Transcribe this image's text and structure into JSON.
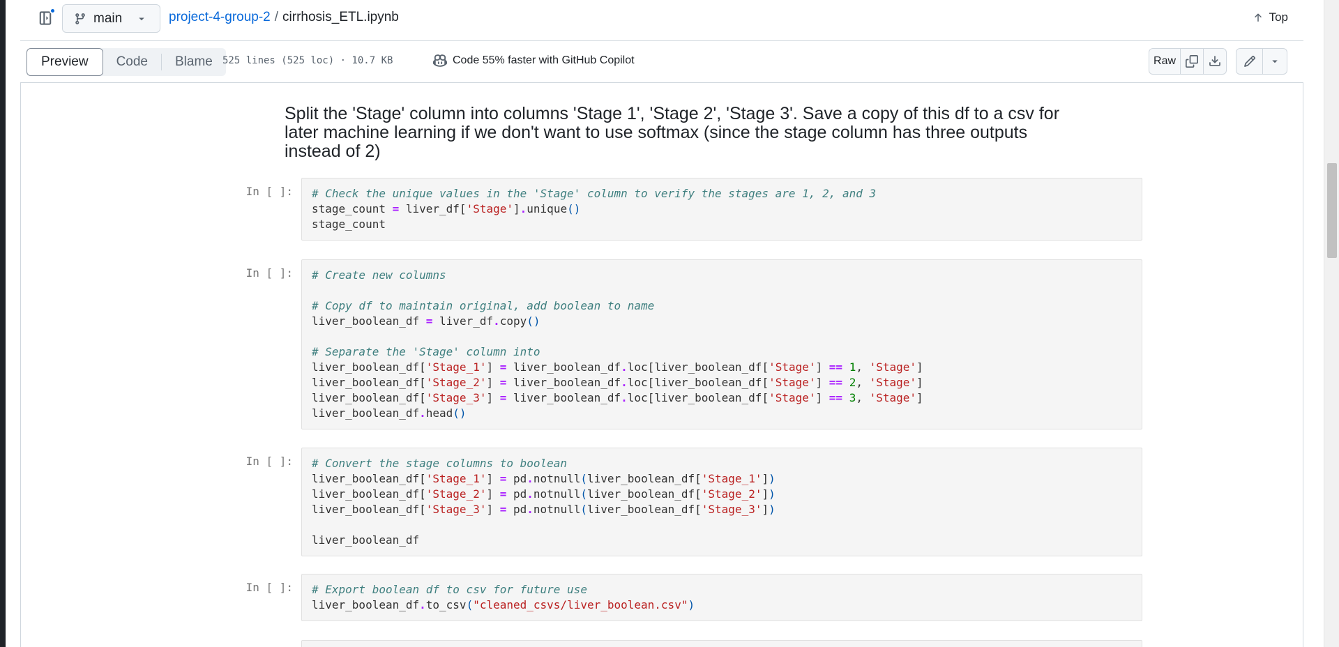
{
  "header": {
    "branch": "main",
    "repo": "project-4-group-2",
    "separator": "/",
    "filename": "cirrhosis_ETL.ipynb",
    "top_label": "Top"
  },
  "toolbar": {
    "tabs": [
      "Preview",
      "Code",
      "Blame"
    ],
    "file_meta": "525 lines (525 loc) · 10.7 KB",
    "copilot_text": "Code 55% faster with GitHub Copilot",
    "raw_label": "Raw"
  },
  "notebook": {
    "heading": "Split the 'Stage' column into columns 'Stage 1', 'Stage 2', 'Stage 3'. Save a copy of this df to a csv for later machine learning if we don't want to use softmax (since the stage column has three outputs instead of 2)",
    "prompt": "In [ ]:"
  },
  "colors": {
    "accent": "#0969da",
    "comment": "#408080",
    "string": "#ba2121",
    "operator": "#aa22ff",
    "number": "#008000"
  }
}
